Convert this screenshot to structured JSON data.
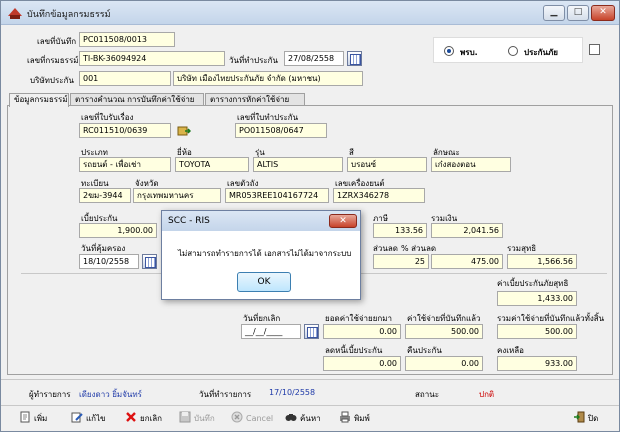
{
  "window": {
    "title": "บันทึกข้อมูลกรมธรรม์",
    "min": "▁",
    "max": "□",
    "close": "✕"
  },
  "header": {
    "doc_no_label": "เลขที่บันทึก",
    "doc_no": "PC011508/0013",
    "policy_no_label": "เลขที่กรมธรรม์",
    "policy_no": "TI-BK-36094924",
    "notify_date_label": "วันที่ทำประกัน",
    "notify_date": "27/08/2558",
    "insurer_label": "บริษัทประกัน",
    "insurer_code": "001",
    "insurer_name": "บริษัท เมืองไทยประกันภัย จำกัด (มหาชน)",
    "radio_prb": "พรบ.",
    "radio_insurance": "ประกันภัย"
  },
  "tabs": [
    {
      "label": "ข้อมูลกรมธรรม์"
    },
    {
      "label": "ตารางคำนวณ การบันทึกค่าใช้จ่าย"
    },
    {
      "label": "ตารางการหักค่าใช้จ่าย"
    }
  ],
  "form": {
    "claim_no_label": "เลขที่ใบรับเรื่อง",
    "claim_no": "RC011510/0639",
    "quote_no_label": "เลขที่ใบทำประกัน",
    "quote_no": "PO011508/0647",
    "type_label": "ประเภท",
    "type": "รถยนต์ - เพื่อเช่า",
    "brand_label": "ยี่ห้อ",
    "brand": "TOYOTA",
    "model_label": "รุ่น",
    "model": "ALTIS",
    "color_label": "สี",
    "color": "บรอนซ์",
    "style_label": "ลักษณะ",
    "style": "เก๋งสองตอน",
    "plate_label": "ทะเบียน",
    "plate": "2ฆม-3944",
    "province_label": "จังหวัด",
    "province": "กรุงเทพมหานคร",
    "chassis_label": "เลขตัวถัง",
    "chassis": "MR053REE104167724",
    "engine_label": "เลขเครื่องยนต์",
    "engine": "1ZRX346278",
    "premium_label": "เบี้ยประกัน",
    "premium": "1,900.00",
    "tax_label": "ภาษี",
    "tax": "133.56",
    "total_label": "รวมเงิน",
    "total": "2,041.56",
    "protect_date_label": "วันที่คุ้มครอง",
    "protect_date": "18/10/2558",
    "discount_label": "ส่วนลด",
    "discount_pct_label": "% ส่วนลด",
    "discount_pct": "25",
    "discount_amount": "475.00",
    "net_label": "รวมสุทธิ",
    "net": "1,566.56",
    "net_premium_label": "ค่าเบี้ยประกันภัยสุทธิ",
    "net_premium": "1,433.00",
    "cancel_date_label": "วันที่ยกเลิก",
    "cancel_date": "__/__/____",
    "paid_label": "ยอดค่าใช้จ่ายยกมา",
    "paid": "0.00",
    "expense_label": "ค่าใช้จ่ายที่บันทึกแล้ว",
    "expense": "500.00",
    "total_expense_label": "รวมค่าใช้จ่ายที่บันทึกแล้วทั้งสิ้น",
    "total_expense": "500.00",
    "deduct_label": "ลดหนี้เบี้ยประกัน",
    "deduct": "0.00",
    "refund_label": "คืนประกัน",
    "refund": "0.00",
    "remain_label": "คงเหลือ",
    "remain": "933.00"
  },
  "dialog": {
    "title": "SCC - RIS",
    "close": "✕",
    "message": "ไม่สามารถทำรายการได้ เอกสารไม่ได้มาจากระบบ",
    "ok": "OK"
  },
  "status": {
    "user_label": "ผู้ทำรายการ",
    "user": "เดียงดาว ยิ้มจันทร์",
    "date_label": "วันที่ทำรายการ",
    "date": "17/10/2558",
    "state_label": "สถานะ",
    "state": "ปกติ"
  },
  "toolbar": {
    "add": "เพิ่ม",
    "edit": "แก้ไข",
    "cancel_doc": "ยกเลิก",
    "save": "บันทึก",
    "cancel": "Cancel",
    "search": "ค้นหา",
    "print": "พิมพ์",
    "close": "ปิด"
  },
  "colors": {
    "field_bg": "#ffffe1",
    "blue_text": "#1f3aa8",
    "red_text": "#cc0000"
  }
}
